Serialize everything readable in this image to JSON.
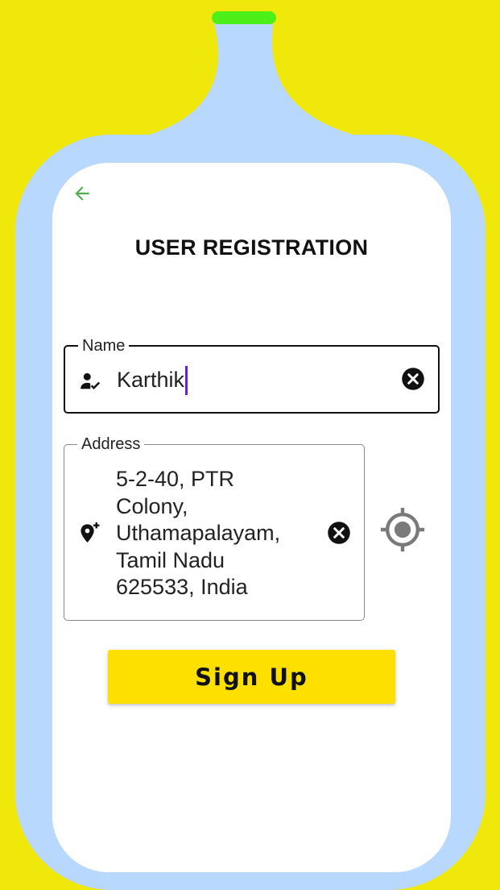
{
  "colors": {
    "background": "#f0e80a",
    "bottle": "#b9d8fd",
    "cap": "#4cf018",
    "card": "#ffffff",
    "back_arrow": "#4caf50",
    "caret": "#6a1ed6",
    "button": "#fde000"
  },
  "header": {
    "back_icon": "arrow-left-icon",
    "title": "USER REGISTRATION"
  },
  "form": {
    "name": {
      "label": "Name",
      "value": "Karthik",
      "icon": "person-check-icon",
      "clear_icon": "clear-circle-icon"
    },
    "address": {
      "label": "Address",
      "lines": [
        "5-2-40, PTR",
        "Colony,",
        "Uthamapalayam,",
        "Tamil Nadu",
        "625533, India"
      ],
      "icon": "add-location-icon",
      "clear_icon": "clear-circle-icon"
    },
    "locate_icon": "gps-fixed-icon",
    "submit_label": "Sign Up"
  }
}
